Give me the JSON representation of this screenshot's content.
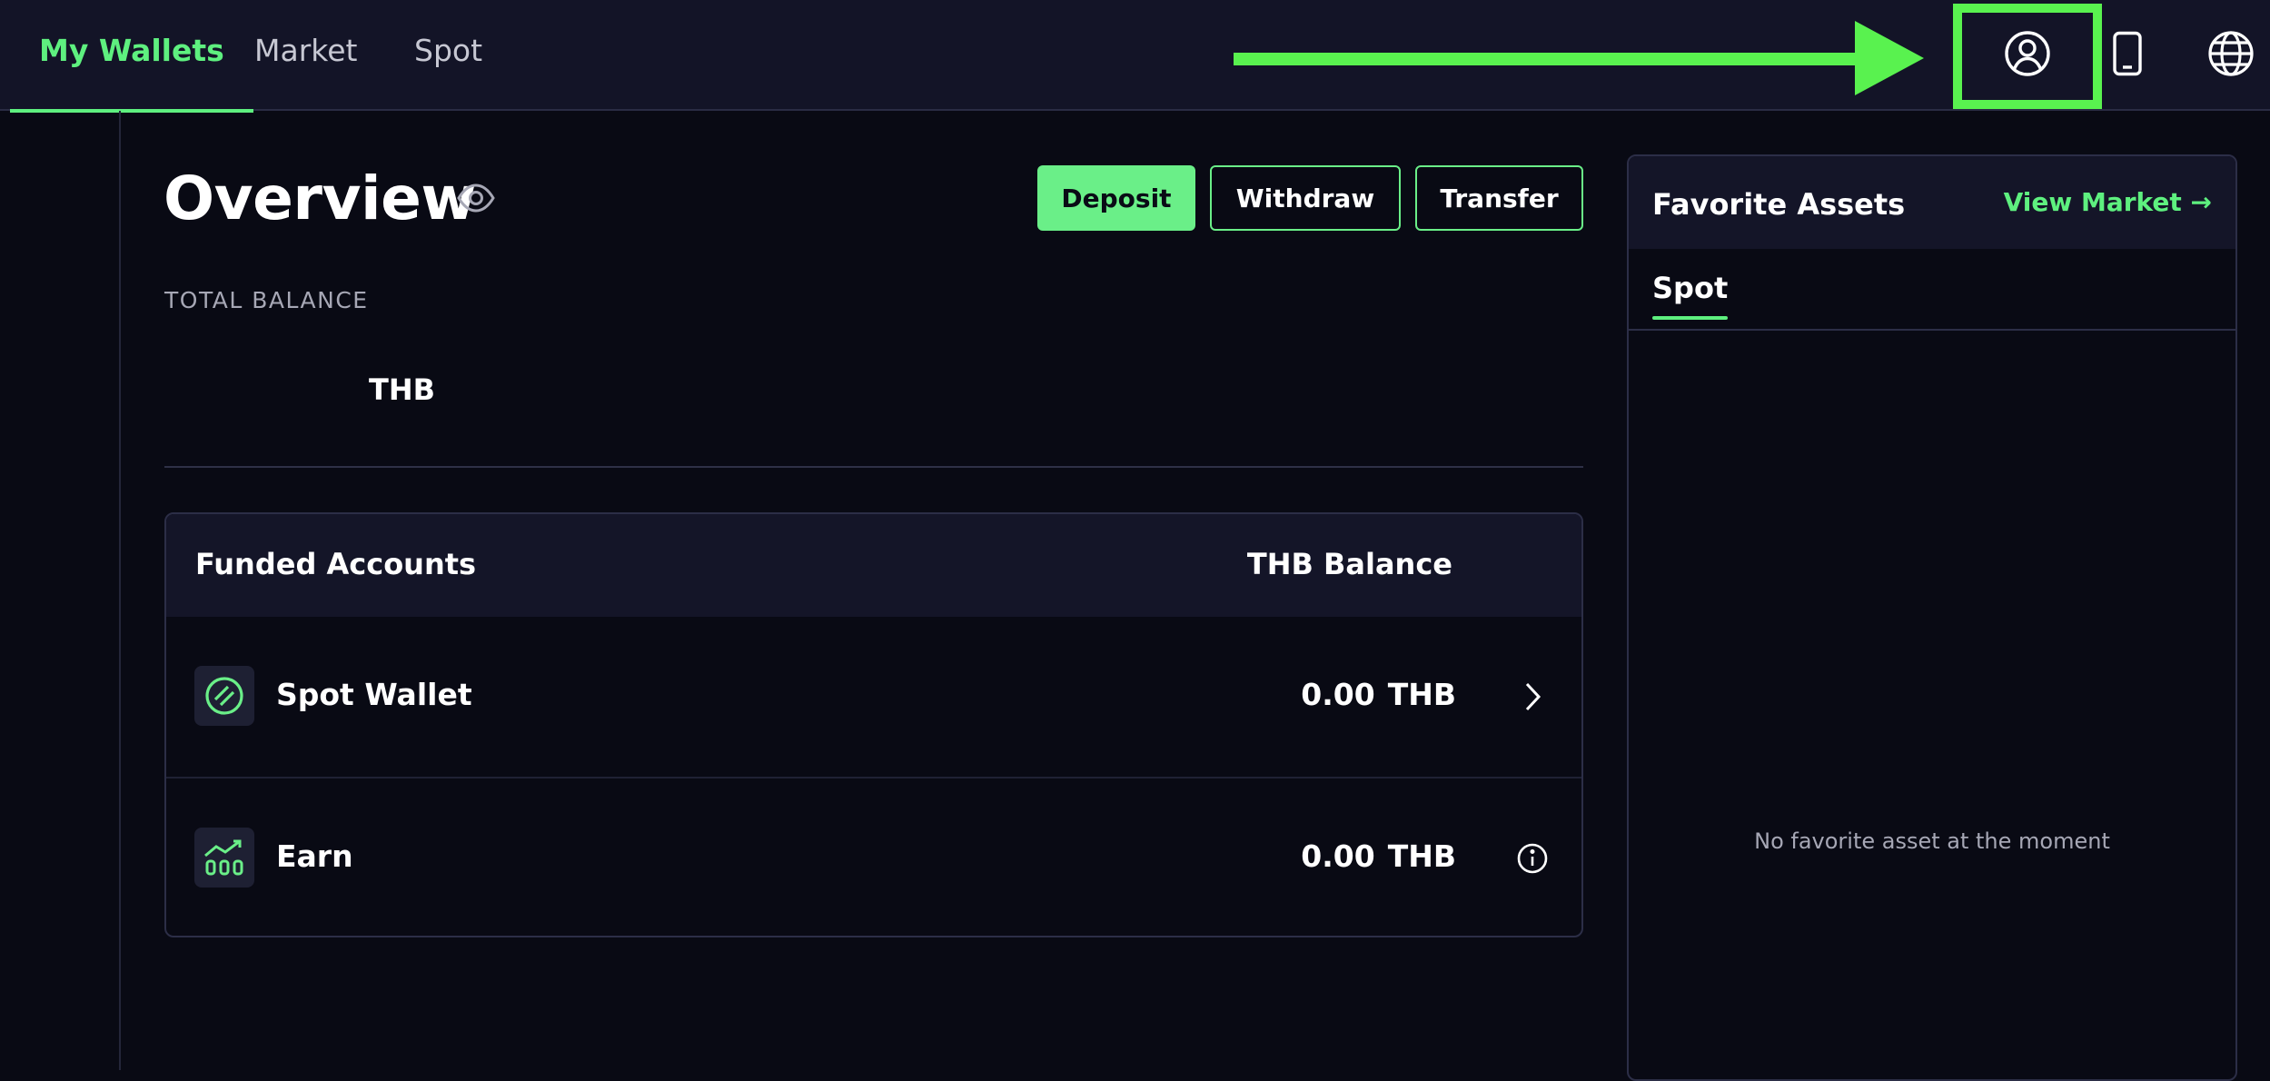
{
  "nav": {
    "tabs": [
      {
        "label": "My Wallets",
        "active": true
      },
      {
        "label": "Market",
        "active": false
      },
      {
        "label": "Spot",
        "active": false
      }
    ],
    "icons": [
      "user-circle-icon",
      "mobile-phone-icon",
      "globe-icon"
    ]
  },
  "annotation": {
    "arrow_color": "#59f24f",
    "highlight_target": "user-circle-icon"
  },
  "overview": {
    "title": "Overview",
    "buttons": {
      "deposit": "Deposit",
      "withdraw": "Withdraw",
      "transfer": "Transfer"
    },
    "total_balance_label": "TOTAL BALANCE",
    "total_balance_currency": "THB"
  },
  "accounts": {
    "header_left": "Funded Accounts",
    "header_right": "THB Balance",
    "rows": [
      {
        "name": "Spot Wallet",
        "value": "0.00",
        "currency": "THB",
        "icon": "spot-wallet-icon",
        "action_icon": "chevron-right-icon"
      },
      {
        "name": "Earn",
        "value": "0.00",
        "currency": "THB",
        "icon": "earn-chart-icon",
        "action_icon": "info-icon"
      }
    ]
  },
  "favorites": {
    "title": "Favorite Assets",
    "link": "View Market →",
    "tab": "Spot",
    "empty": "No favorite asset at the moment"
  },
  "colors": {
    "accent": "#5ef07f",
    "background": "#090a14",
    "panel": "#131427"
  }
}
